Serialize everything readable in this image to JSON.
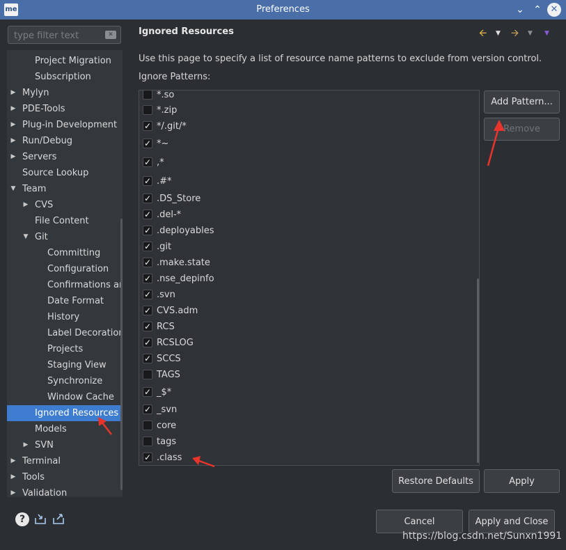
{
  "window": {
    "app_badge": "me",
    "title": "Preferences",
    "minimize_icon": "chevron-down-icon",
    "maximize_icon": "chevron-up-icon",
    "close_icon": "close-icon"
  },
  "filter": {
    "placeholder": "type filter text",
    "clear_icon": "clear-icon"
  },
  "tree": [
    {
      "label": "Project Migration",
      "indent": 1,
      "arrow": ""
    },
    {
      "label": "Subscription",
      "indent": 1,
      "arrow": ""
    },
    {
      "label": "Mylyn",
      "indent": 0,
      "arrow": "right"
    },
    {
      "label": "PDE-Tools",
      "indent": 0,
      "arrow": "right"
    },
    {
      "label": "Plug-in Development",
      "indent": 0,
      "arrow": "right"
    },
    {
      "label": "Run/Debug",
      "indent": 0,
      "arrow": "right"
    },
    {
      "label": "Servers",
      "indent": 0,
      "arrow": "right"
    },
    {
      "label": "Source Lookup",
      "indent": 0,
      "arrow": ""
    },
    {
      "label": "Team",
      "indent": 0,
      "arrow": "down"
    },
    {
      "label": "CVS",
      "indent": 1,
      "arrow": "right"
    },
    {
      "label": "File Content",
      "indent": 1,
      "arrow": ""
    },
    {
      "label": "Git",
      "indent": 1,
      "arrow": "down"
    },
    {
      "label": "Committing",
      "indent": 2,
      "arrow": ""
    },
    {
      "label": "Configuration",
      "indent": 2,
      "arrow": ""
    },
    {
      "label": "Confirmations ar",
      "indent": 2,
      "arrow": ""
    },
    {
      "label": "Date Format",
      "indent": 2,
      "arrow": ""
    },
    {
      "label": "History",
      "indent": 2,
      "arrow": ""
    },
    {
      "label": "Label Decoration",
      "indent": 2,
      "arrow": ""
    },
    {
      "label": "Projects",
      "indent": 2,
      "arrow": ""
    },
    {
      "label": "Staging View",
      "indent": 2,
      "arrow": ""
    },
    {
      "label": "Synchronize",
      "indent": 2,
      "arrow": ""
    },
    {
      "label": "Window Cache",
      "indent": 2,
      "arrow": ""
    },
    {
      "label": "Ignored Resources",
      "indent": 1,
      "arrow": "",
      "selected": true
    },
    {
      "label": "Models",
      "indent": 1,
      "arrow": ""
    },
    {
      "label": "SVN",
      "indent": 1,
      "arrow": "right"
    },
    {
      "label": "Terminal",
      "indent": 0,
      "arrow": "right"
    },
    {
      "label": "Tools",
      "indent": 0,
      "arrow": "right"
    },
    {
      "label": "Validation",
      "indent": 0,
      "arrow": "right"
    }
  ],
  "page": {
    "title": "Ignored Resources",
    "description": "Use this page to specify a list of resource name patterns to exclude from version control.",
    "patterns_label": "Ignore Patterns:"
  },
  "nav_icons": [
    "back-arrow-icon",
    "back-menu-icon",
    "forward-arrow-icon",
    "forward-menu-icon",
    "view-menu-icon"
  ],
  "patterns": [
    {
      "name": "*.so",
      "checked": false
    },
    {
      "name": "*.zip",
      "checked": false
    },
    {
      "name": "*/.git/*",
      "checked": true
    },
    {
      "name": "*~",
      "checked": true
    },
    {
      "name": ",*",
      "checked": true
    },
    {
      "name": ".#*",
      "checked": true
    },
    {
      "name": ".DS_Store",
      "checked": true
    },
    {
      "name": ".del-*",
      "checked": true
    },
    {
      "name": ".deployables",
      "checked": true
    },
    {
      "name": ".git",
      "checked": true
    },
    {
      "name": ".make.state",
      "checked": true
    },
    {
      "name": ".nse_depinfo",
      "checked": true
    },
    {
      "name": ".svn",
      "checked": true
    },
    {
      "name": "CVS.adm",
      "checked": true
    },
    {
      "name": "RCS",
      "checked": true
    },
    {
      "name": "RCSLOG",
      "checked": true
    },
    {
      "name": "SCCS",
      "checked": true
    },
    {
      "name": "TAGS",
      "checked": false
    },
    {
      "name": "_$*",
      "checked": true
    },
    {
      "name": "_svn",
      "checked": true
    },
    {
      "name": "core",
      "checked": false
    },
    {
      "name": "tags",
      "checked": false
    },
    {
      "name": ".class",
      "checked": true
    }
  ],
  "buttons": {
    "add_pattern": "Add Pattern...",
    "remove": "Remove",
    "restore_defaults": "Restore Defaults",
    "apply": "Apply",
    "cancel": "Cancel",
    "apply_and_close": "Apply and Close"
  },
  "bottom_icons": [
    "help-icon",
    "import-icon",
    "export-icon"
  ],
  "colors": {
    "titlebar": "#4a6fa8",
    "selection": "#3e7ccf",
    "background": "#2b2f33",
    "annotation_arrow": "#e8342c"
  },
  "watermark": "https://blog.csdn.net/Sunxn1991"
}
